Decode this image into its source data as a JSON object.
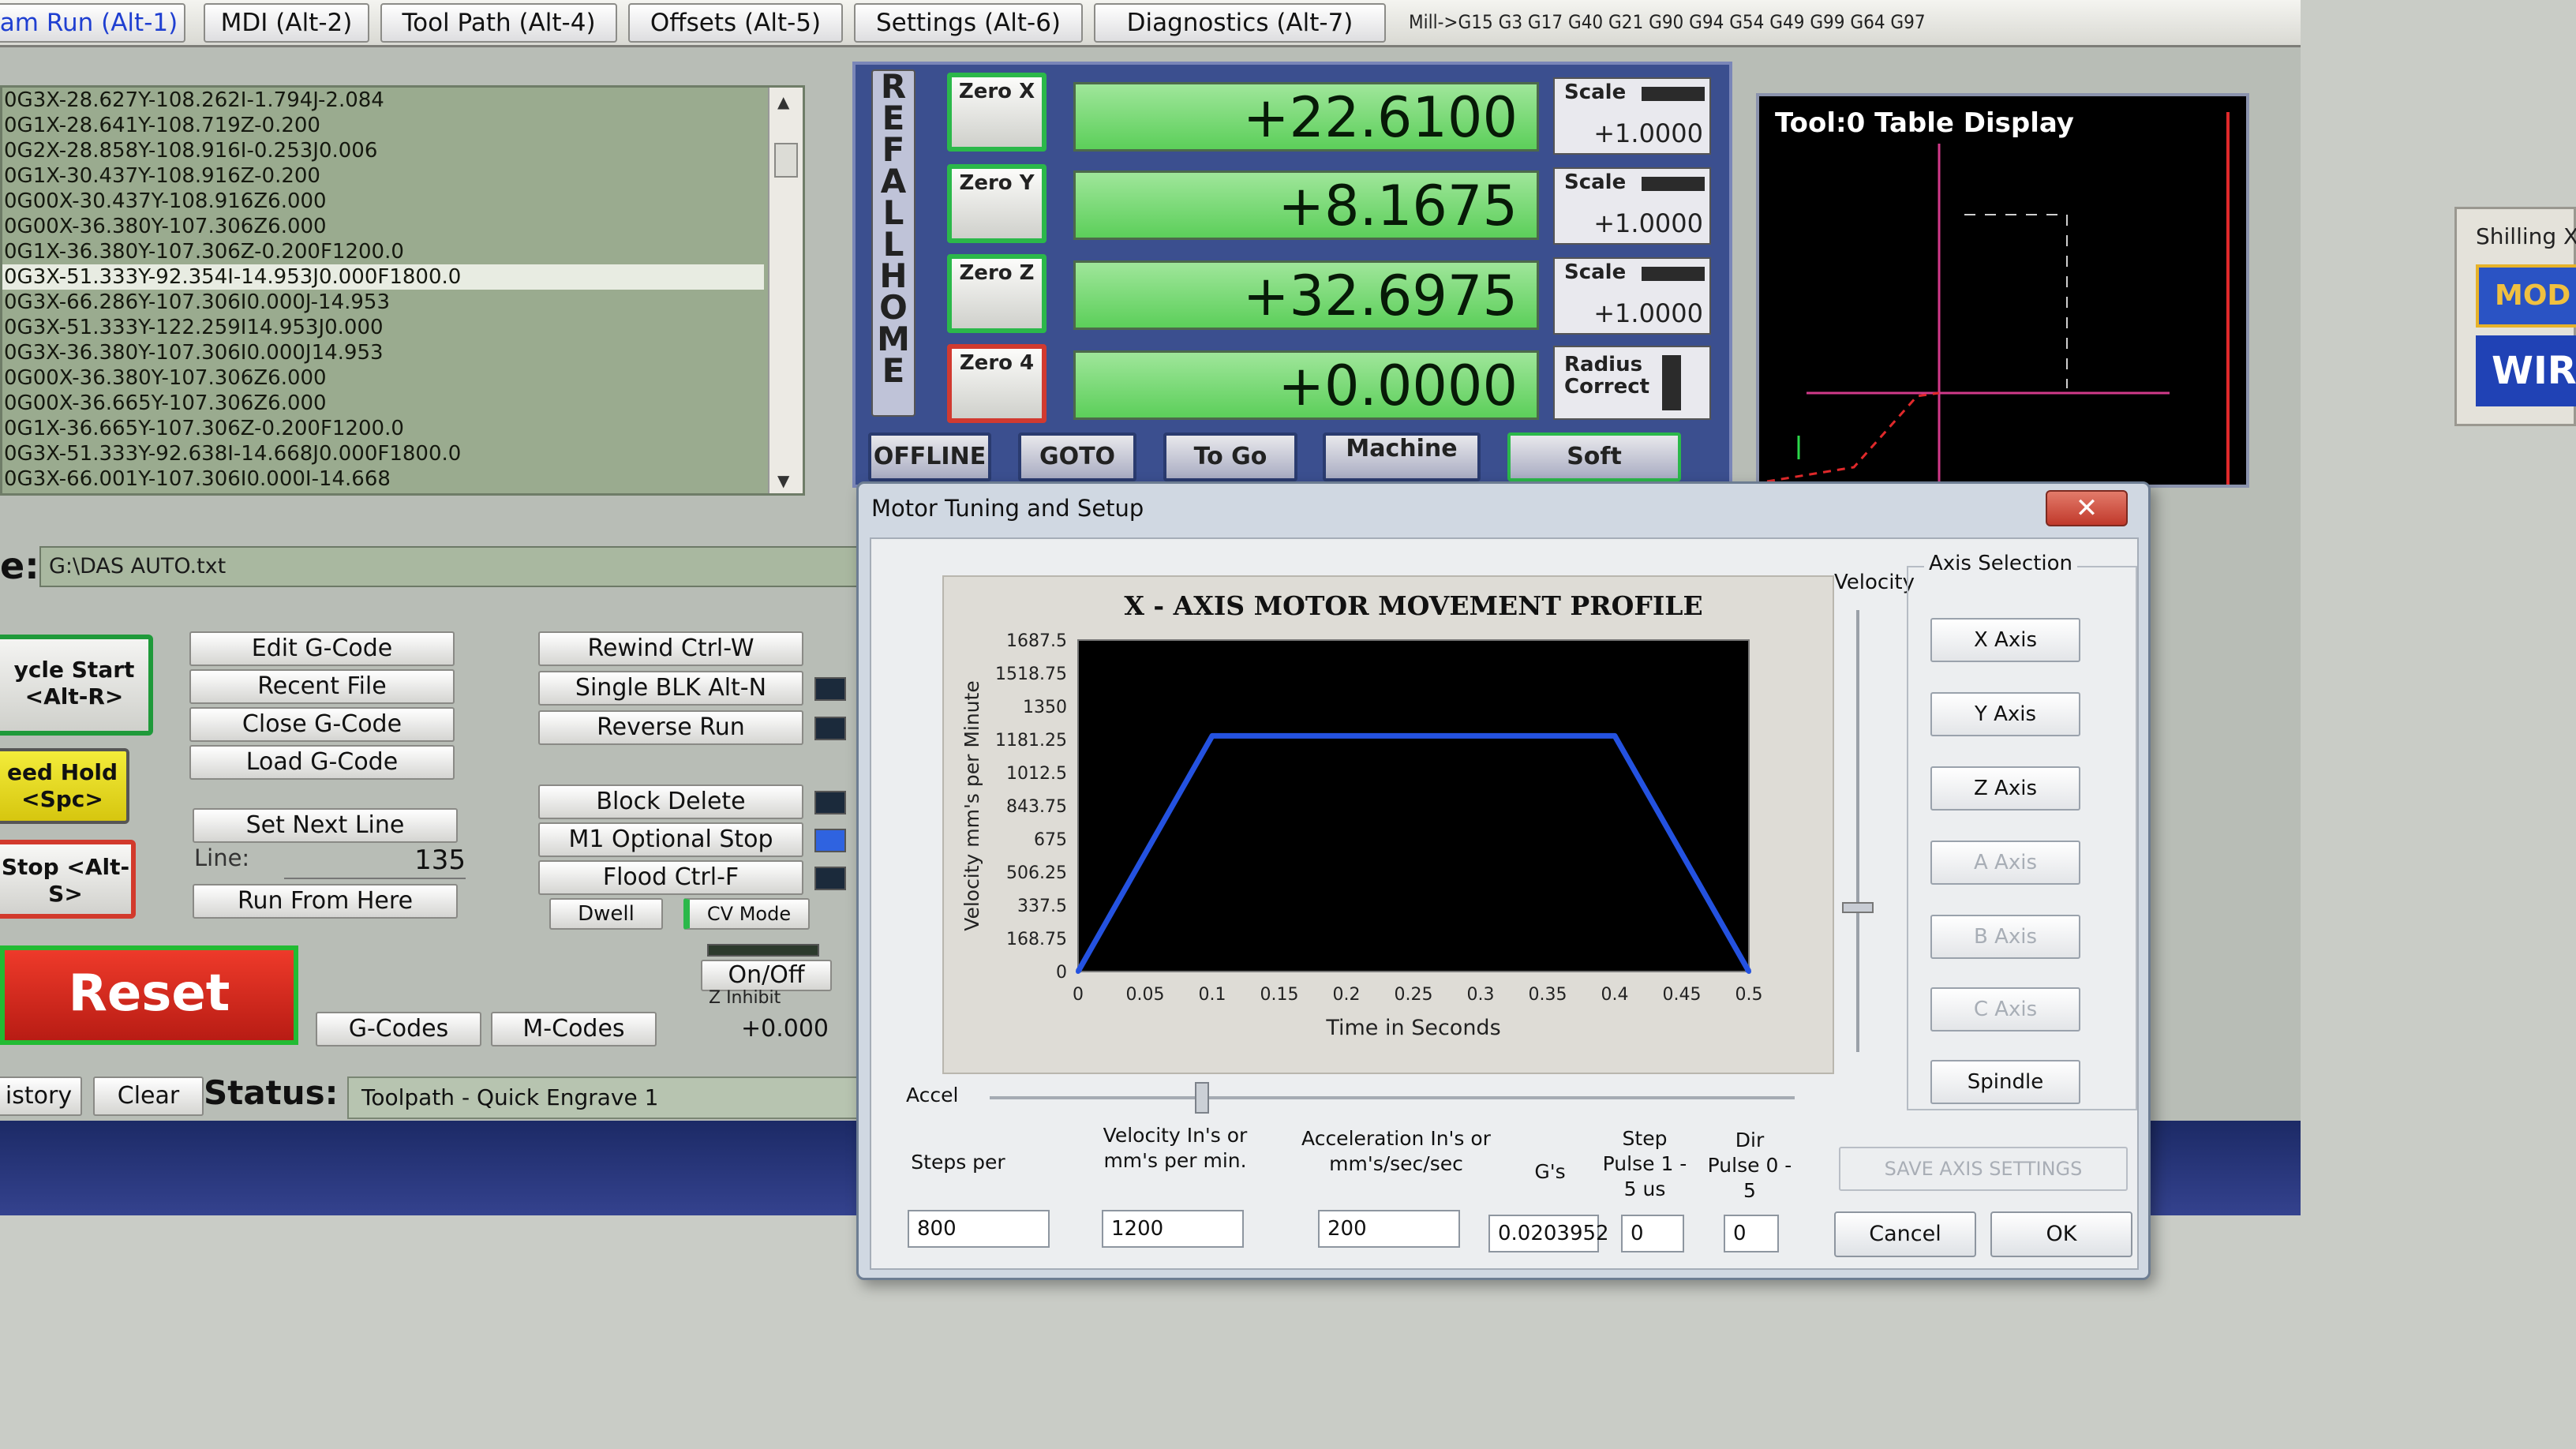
{
  "tabs": [
    "am Run (Alt-1)",
    "MDI (Alt-2)",
    "Tool Path (Alt-4)",
    "Offsets (Alt-5)",
    "Settings (Alt-6)",
    "Diagnostics (Alt-7)"
  ],
  "modal_line": "Mill->G15  G3 G17 G40 G21 G90 G94 G54 G49 G99 G64 G97",
  "gcode_lines": [
    "0G3X-28.627Y-108.262I-1.794J-2.084",
    "0G1X-28.641Y-108.719Z-0.200",
    "0G2X-28.858Y-108.916I-0.253J0.006",
    "0G1X-30.437Y-108.916Z-0.200",
    "0G00X-30.437Y-108.916Z6.000",
    "0G00X-36.380Y-107.306Z6.000",
    "0G1X-36.380Y-107.306Z-0.200F1200.0",
    "0G3X-51.333Y-92.354I-14.953J0.000F1800.0",
    "0G3X-66.286Y-107.306I0.000J-14.953",
    "0G3X-51.333Y-122.259I14.953J0.000",
    "0G3X-36.380Y-107.306I0.000J14.953",
    "0G00X-36.380Y-107.306Z6.000",
    "0G00X-36.665Y-107.306Z6.000",
    "0G1X-36.665Y-107.306Z-0.200F1200.0",
    "0G3X-51.333Y-92.638I-14.668J0.000F1800.0",
    "0G3X-66.001Y-107.306I0.000I-14.668"
  ],
  "file": {
    "label": "e:",
    "path": "G:\\DAS AUTO.txt"
  },
  "buttons": {
    "cycle_start": "ycle Start <Alt-R>",
    "feed_hold": "eed Hold <Spc>",
    "stop": "Stop <Alt-S>",
    "edit_gcode": "Edit G-Code",
    "recent_file": "Recent File",
    "close_gcode": "Close G-Code",
    "load_gcode": "Load G-Code",
    "set_next_line": "Set Next Line",
    "line_label": "Line:",
    "line_value": "135",
    "run_from_here": "Run From Here",
    "rewind": "Rewind Ctrl-W",
    "single_blk": "Single BLK Alt-N",
    "reverse_run": "Reverse Run",
    "block_delete": "Block Delete",
    "m1_optional_stop": "M1 Optional Stop",
    "flood": "Flood Ctrl-F",
    "dwell": "Dwell",
    "cv_mode": "CV Mode",
    "on_off": "On/Off",
    "z_inhibit": "Z Inhibit",
    "z_inhibit_value": "+0.000",
    "reset": "Reset",
    "gcodes": "G-Codes",
    "mcodes": "M-Codes",
    "history": "istory",
    "clear": "Clear"
  },
  "status": {
    "label": "Status:",
    "text": "Toolpath - Quick Engrave 1"
  },
  "dro": {
    "ref_all_home": [
      "R",
      "E",
      "F",
      "A",
      "L",
      "L",
      "H",
      "O",
      "M",
      "E"
    ],
    "axes": [
      {
        "zero_label": "Zero X",
        "value": "+22.6100",
        "scale_label": "Scale",
        "scale_value": "+1.0000"
      },
      {
        "zero_label": "Zero Y",
        "value": "+8.1675",
        "scale_label": "Scale",
        "scale_value": "+1.0000"
      },
      {
        "zero_label": "Zero Z",
        "value": "+32.6975",
        "scale_label": "Scale",
        "scale_value": "+1.0000"
      },
      {
        "zero_label": "Zero 4",
        "value": "+0.0000",
        "scale_label": "Radius Correct",
        "scale_value": ""
      }
    ],
    "mode_buttons": [
      "OFFLINE",
      "GOTO",
      "To Go",
      "Machine",
      "Soft"
    ]
  },
  "toolpath_display": {
    "label": "Tool:0   Table Display"
  },
  "right_panel": {
    "label": "Shilling X",
    "mod": "MOD",
    "wir": "WIR"
  },
  "dialog": {
    "title": "Motor Tuning and Setup",
    "close": "✕",
    "velocity_label": "Velocity",
    "accel_label": "Accel",
    "axis_selection_label": "Axis Selection",
    "axis_buttons": [
      {
        "label": "X Axis",
        "enabled": true
      },
      {
        "label": "Y Axis",
        "enabled": true
      },
      {
        "label": "Z Axis",
        "enabled": true
      },
      {
        "label": "A Axis",
        "enabled": false
      },
      {
        "label": "B Axis",
        "enabled": false
      },
      {
        "label": "C Axis",
        "enabled": false
      },
      {
        "label": "Spindle",
        "enabled": true
      }
    ],
    "fields": [
      {
        "label": "Steps per",
        "value": "800"
      },
      {
        "label": "Velocity In's or mm's per min.",
        "value": "1200"
      },
      {
        "label": "Acceleration In's or mm's/sec/sec",
        "value": "200"
      },
      {
        "label": "G's",
        "value": "0.0203952"
      },
      {
        "label": "Step Pulse 1 - 5 us",
        "value": "0"
      },
      {
        "label": "Dir Pulse 0 - 5",
        "value": "0"
      }
    ],
    "save_axis_settings": "SAVE AXIS SETTINGS",
    "cancel": "Cancel",
    "ok": "OK"
  },
  "chart_data": {
    "type": "line",
    "title": "X - AXIS MOTOR MOVEMENT PROFILE",
    "xlabel": "Time in Seconds",
    "ylabel": "Velocity  mm's per Minute",
    "xlim": [
      0,
      0.5
    ],
    "ylim": [
      0,
      1687.5
    ],
    "x_ticks": [
      "0",
      "0.05",
      "0.1",
      "0.15",
      "0.2",
      "0.25",
      "0.3",
      "0.35",
      "0.4",
      "0.45",
      "0.5"
    ],
    "y_ticks": [
      "0",
      "168.75",
      "337.5",
      "506.25",
      "675",
      "843.75",
      "1012.5",
      "1181.25",
      "1350",
      "1518.75",
      "1687.5"
    ],
    "series": [
      {
        "x": [
          0,
          0.1,
          0.4,
          0.5
        ],
        "y": [
          0,
          1200,
          1200,
          0
        ],
        "color": "#2452e0"
      }
    ],
    "plot_background": "#000000",
    "grid": false
  }
}
